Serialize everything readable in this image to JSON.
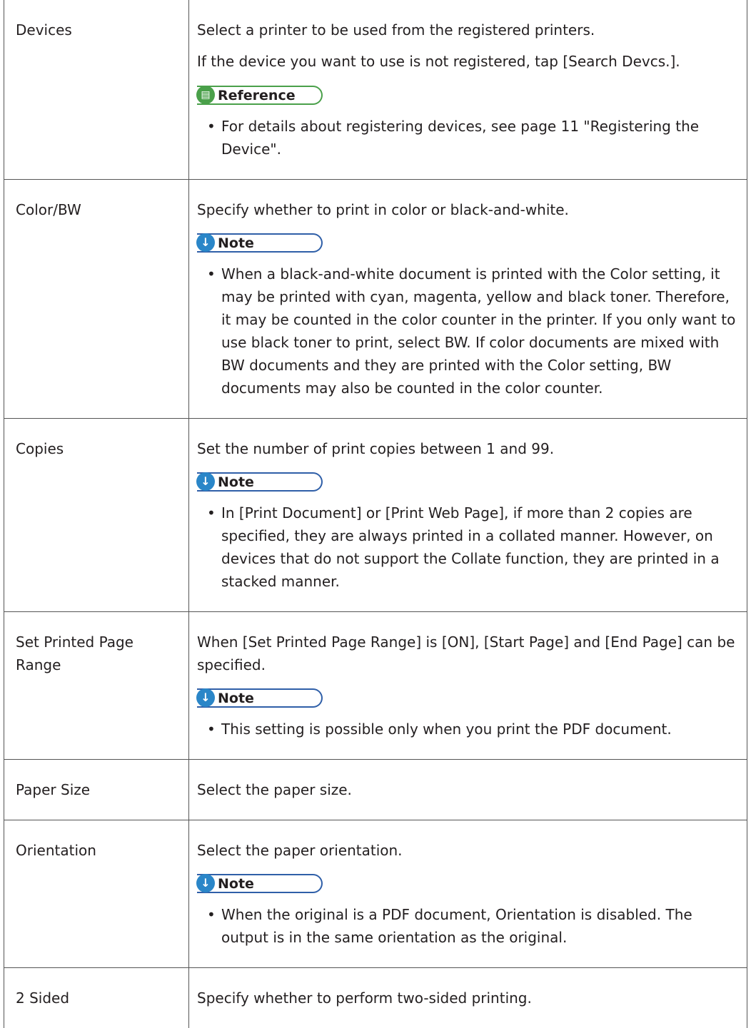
{
  "rows": [
    {
      "name": "Devices",
      "paragraphs": [
        "Select a printer to be used from the registered printers.",
        "If the device you want to use is not registered, tap [Search Devcs.]."
      ],
      "callout_label": "Reference",
      "bullets": [
        "For details about registering devices, see page 11 \"Registering the Device\"."
      ]
    },
    {
      "name": "Color/BW",
      "paragraphs": [
        "Specify whether to print in color or black-and-white."
      ],
      "callout_label": "Note",
      "bullets": [
        "When a black-and-white document is printed with the Color setting, it may be printed with cyan, magenta, yellow and black toner. Therefore, it may be counted in the color counter in the printer. If you only want to use black toner to print, select BW. If color documents are mixed with BW documents and they are printed with the Color setting, BW documents may also be counted in the color counter."
      ]
    },
    {
      "name": "Copies",
      "paragraphs": [
        "Set the number of print copies between 1 and 99."
      ],
      "callout_label": "Note",
      "bullets": [
        "In [Print Document] or [Print Web Page], if more than 2 copies are specified, they are always printed in a collated manner. However, on devices that do not support the Collate function, they are printed in a stacked manner."
      ]
    },
    {
      "name": "Set Printed Page Range",
      "paragraphs": [
        "When [Set Printed Page Range] is [ON], [Start Page] and [End Page] can be specified."
      ],
      "callout_label": "Note",
      "bullets": [
        "This setting is possible only when you print the PDF document."
      ]
    },
    {
      "name": "Paper Size",
      "paragraphs": [
        "Select the paper size."
      ]
    },
    {
      "name": "Orientation",
      "paragraphs": [
        "Select the paper orientation."
      ],
      "callout_label": "Note",
      "bullets": [
        "When the original is a PDF document, Orientation is disabled. The output is in the same orientation as the original."
      ]
    },
    {
      "name": "2 Sided",
      "paragraphs": [
        "Specify whether to perform two-sided printing."
      ]
    }
  ],
  "icons": {
    "reference": "reference-icon",
    "note": "note-down-arrow-icon"
  },
  "colors": {
    "text": "#231f20",
    "border": "#555555",
    "note_icon": "#2a86c8",
    "note_outline": "#2f5fa8",
    "reference_icon": "#4aa04a"
  }
}
